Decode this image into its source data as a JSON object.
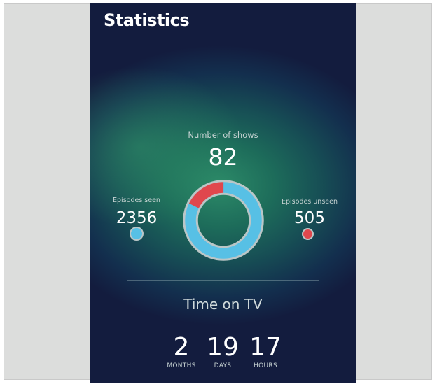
{
  "header": {
    "title": "Statistics"
  },
  "shows": {
    "label": "Number of shows",
    "value": "82"
  },
  "episodes_seen": {
    "label": "Episodes seen",
    "value": "2356"
  },
  "episodes_unseen": {
    "label": "Episodes unseen",
    "value": "505"
  },
  "donut": {
    "seen_fraction": 0.823,
    "unseen_fraction": 0.177
  },
  "time_on_tv": {
    "title": "Time on TV",
    "months": {
      "value": "2",
      "unit": "MONTHS"
    },
    "days": {
      "value": "19",
      "unit": "DAYS"
    },
    "hours": {
      "value": "17",
      "unit": "HOURS"
    }
  },
  "colors": {
    "seen": "#57c0e5",
    "unseen": "#e0474d",
    "ring_border": "#bac6c7",
    "background_dark": "#131c3e",
    "background_green": "#2c8a68"
  }
}
